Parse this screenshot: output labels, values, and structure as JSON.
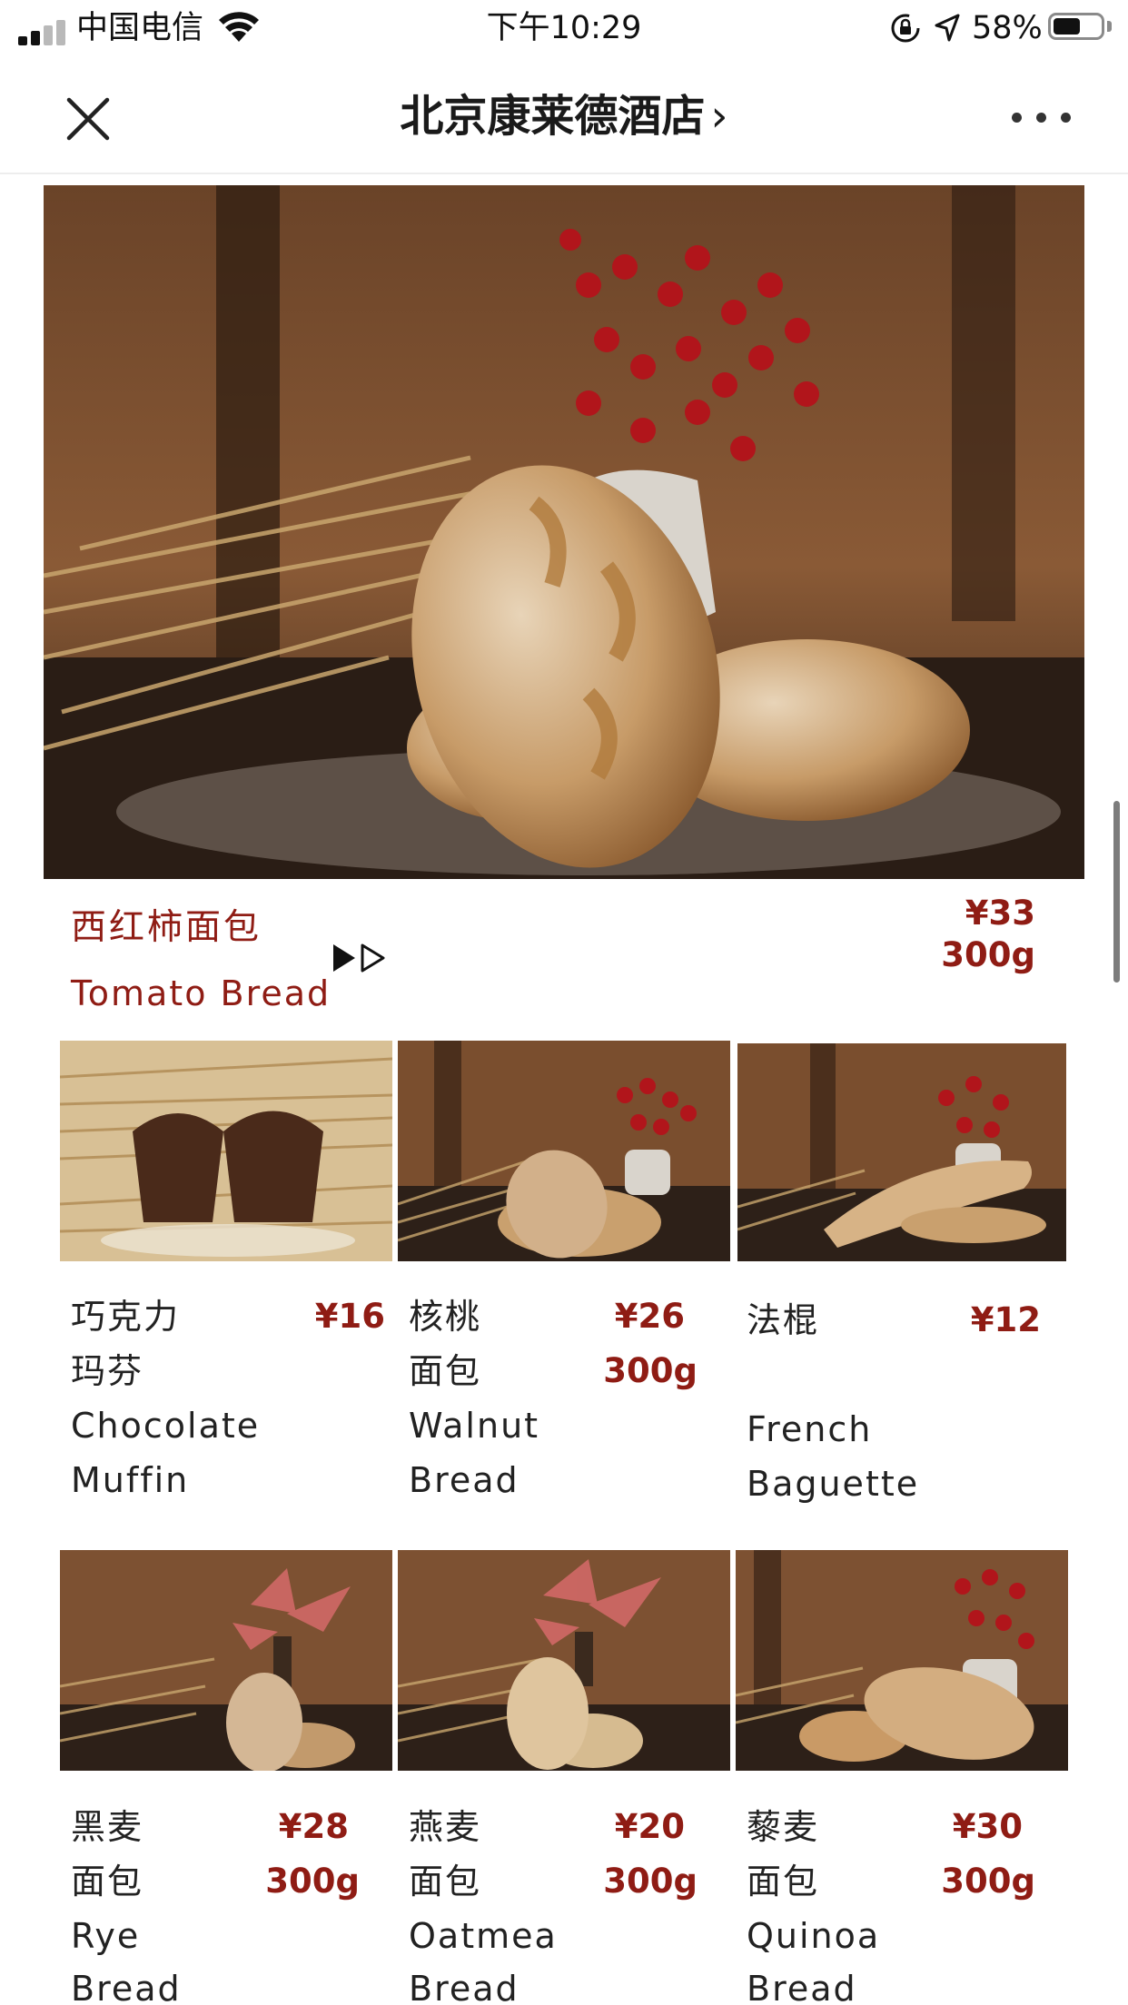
{
  "status": {
    "carrier": "中国电信",
    "time": "下午10:29",
    "battery": "58%",
    "battery_level": 0.58
  },
  "nav": {
    "title": "北京康莱德酒店",
    "chevron": "›"
  },
  "hero": {
    "name_zh": "西红柿面包",
    "name_en": "Tomato Bread",
    "price": "¥33",
    "weight": "300g"
  },
  "products": [
    {
      "zh1": "巧克力",
      "zh2": "玛芬",
      "en1": "Chocolate",
      "en2": "Muffin",
      "price": "¥16",
      "weight": ""
    },
    {
      "zh1": "核桃",
      "zh2": "面包",
      "en1": "Walnut",
      "en2": "Bread",
      "price": "¥26",
      "weight": "300g"
    },
    {
      "zh1": "法棍",
      "zh2": "",
      "en1": "French",
      "en2": "Baguette",
      "price": "¥12",
      "weight": ""
    },
    {
      "zh1": "黑麦",
      "zh2": "面包",
      "en1": "Rye",
      "en2": "Bread",
      "price": "¥28",
      "weight": "300g"
    },
    {
      "zh1": "燕麦",
      "zh2": "面包",
      "en1": "Oatmea",
      "en2": "Bread",
      "price": "¥20",
      "weight": "300g"
    },
    {
      "zh1": "藜麦",
      "zh2": "面包",
      "en1": "Quinoa",
      "en2": "Bread",
      "price": "¥30",
      "weight": "300g"
    }
  ],
  "icons": {
    "close": "close-icon",
    "more": "more-icon",
    "play": "play-icon",
    "wifi": "wifi-icon",
    "location": "location-arrow-icon",
    "rotation_lock": "rotation-lock-icon"
  }
}
